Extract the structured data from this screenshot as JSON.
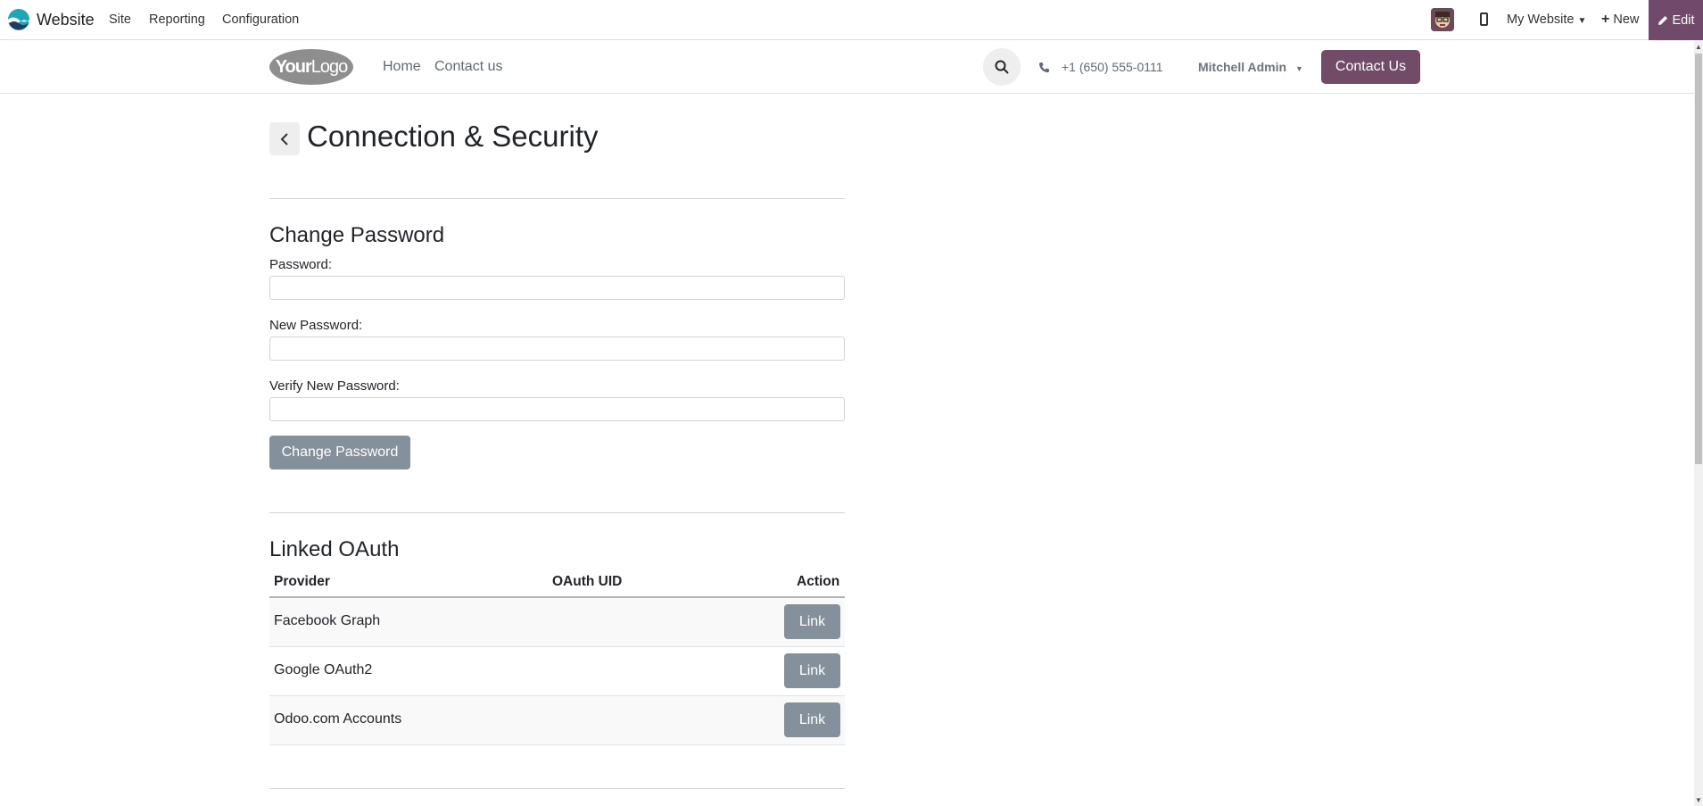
{
  "admin_bar": {
    "app_name": "Website",
    "menus": [
      "Site",
      "Reporting",
      "Configuration"
    ],
    "website_selector": "My Website",
    "new_label": "New",
    "edit_label": "Edit"
  },
  "site_header": {
    "logo_bold": "Your",
    "logo_rest": "Logo",
    "nav": [
      "Home",
      "Contact us"
    ],
    "phone": "+1 (650) 555-0111",
    "user": "Mitchell Admin",
    "cta": "Contact Us"
  },
  "page": {
    "title": "Connection & Security"
  },
  "change_password": {
    "heading": "Change Password",
    "password_label": "Password:",
    "new_password_label": "New Password:",
    "verify_label": "Verify New Password:",
    "button": "Change Password"
  },
  "oauth": {
    "heading": "Linked OAuth",
    "columns": [
      "Provider",
      "OAuth UID",
      "Action"
    ],
    "rows": [
      {
        "provider": "Facebook Graph",
        "uid": "",
        "action": "Link"
      },
      {
        "provider": "Google OAuth2",
        "uid": "",
        "action": "Link"
      },
      {
        "provider": "Odoo.com Accounts",
        "uid": "",
        "action": "Link"
      }
    ]
  },
  "colors": {
    "brand": "#714b67",
    "button_grey": "#84909b"
  }
}
